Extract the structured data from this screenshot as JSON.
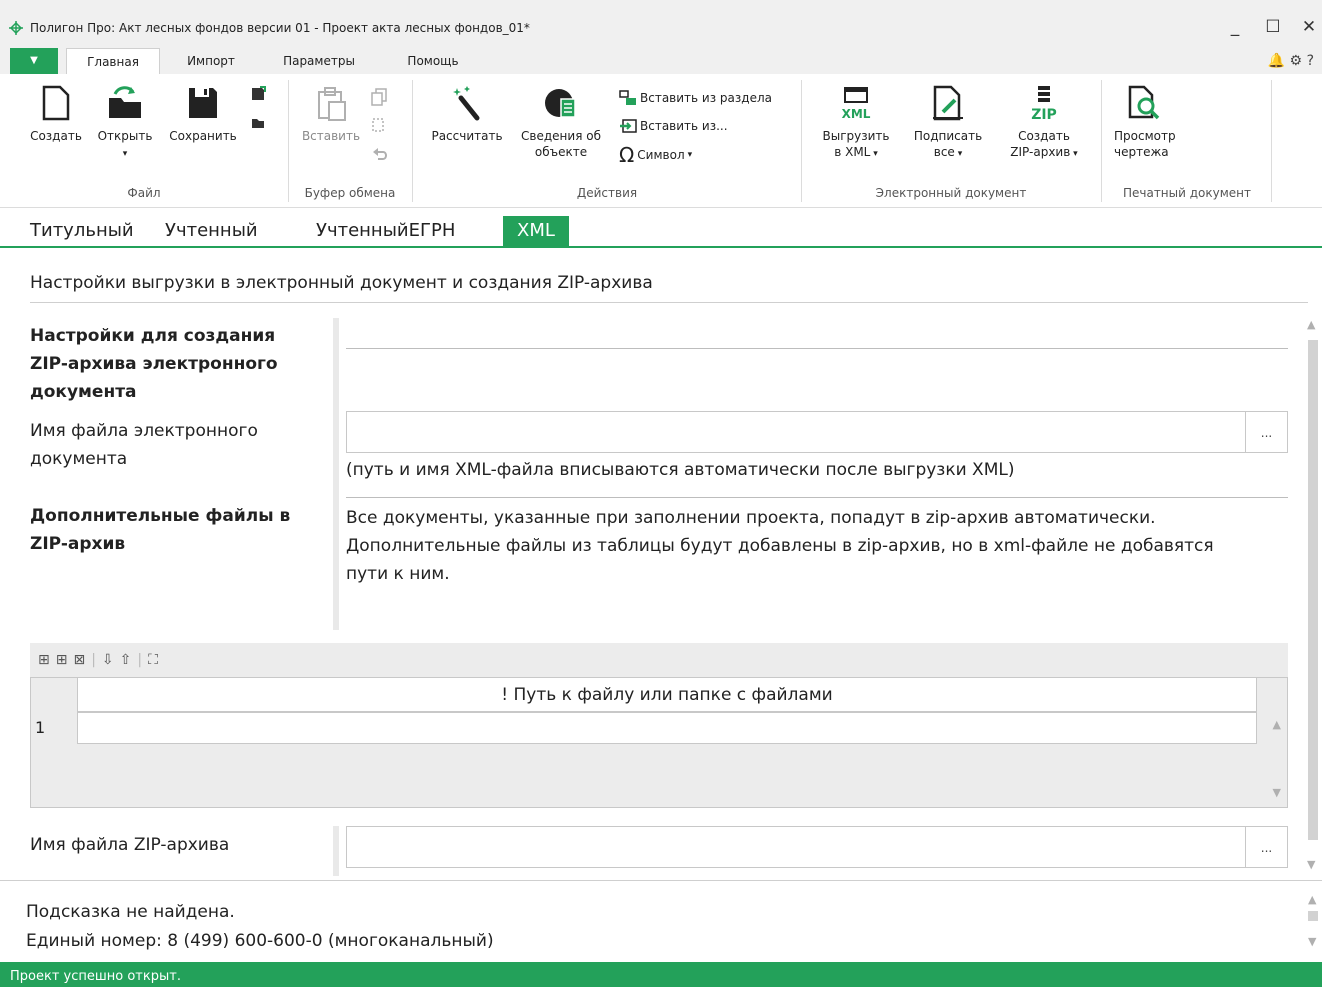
{
  "window": {
    "title": "Полигон Про: Акт лесных фондов версии 01 - Проект акта лесных фондов_01*",
    "minimize": "_",
    "maximize": "☐",
    "close": "✕"
  },
  "menu": {
    "dropdown": "▼",
    "tabs": [
      "Главная",
      "Импорт",
      "Параметры",
      "Помощь"
    ],
    "active_tab": "Главная",
    "right_icons": [
      "bell-icon",
      "gear-icon",
      "help-icon"
    ],
    "help": "?"
  },
  "ribbon": {
    "file": {
      "label": "Файл",
      "create": "Создать",
      "open": "Открыть",
      "save": "Сохранить"
    },
    "clipboard": {
      "label": "Буфер обмена",
      "paste": "Вставить"
    },
    "actions": {
      "label": "Действия",
      "calculate": "Рассчитать",
      "object_info_1": "Сведения об",
      "object_info_2": "объекте",
      "paste_section": "Вставить из раздела",
      "paste_from": "Вставить из...",
      "symbol": "Символ"
    },
    "edoc": {
      "label": "Электронный документ",
      "export_1": "Выгрузить",
      "export_2": "в XML",
      "sign_1": "Подписать",
      "sign_2": "все",
      "zip_1": "Создать",
      "zip_2": "ZIP-архив",
      "xml_badge": "XML",
      "zip_badge": "ZIP"
    },
    "print": {
      "label": "Печатный документ",
      "preview_1": "Просмотр",
      "preview_2": "чертежа"
    }
  },
  "doc_tabs": [
    "Титульный",
    "Учтенный",
    "УчтенныйЕГРН",
    "XML"
  ],
  "active_doc_tab": "XML",
  "content": {
    "section_title": "Настройки выгрузки в электронный документ и создания ZIP-архива",
    "zip_settings_1": "Настройки для создания",
    "zip_settings_2": "ZIP-архива электронного",
    "zip_settings_3": "документа",
    "edoc_name_1": "Имя файла электронного",
    "edoc_name_2": "документа",
    "edoc_name_value": "",
    "edoc_name_hint": "(путь и имя XML-файла вписываются автоматически после выгрузки XML)",
    "browse": "...",
    "extra_files_1": "Дополнительные файлы в",
    "extra_files_2": "ZIP-архив",
    "extra_desc_1": "Все документы, указанные при заполнении проекта, попадут в zip-архив автоматически.",
    "extra_desc_2": "Дополнительные файлы из таблицы будут добавлены в zip-архив, но в xml-файле не добавятся",
    "extra_desc_3": "пути к ним.",
    "grid": {
      "column": "! Путь к файлу или папке с файлами",
      "rows": [
        {
          "num": "1",
          "path": ""
        }
      ]
    },
    "zip_name_label": "Имя файла ZIP-архива",
    "zip_name_value": ""
  },
  "hint": {
    "line1": "Подсказка не найдена.",
    "line2": "Единый номер: 8 (499) 600-600-0 (многоканальный)"
  },
  "status": "Проект успешно открыт.",
  "colors": {
    "accent": "#23a15a"
  }
}
